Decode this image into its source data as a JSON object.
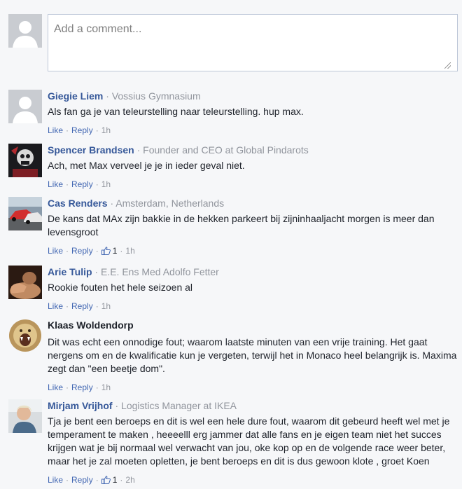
{
  "composer": {
    "placeholder": "Add a comment..."
  },
  "actions": {
    "like": "Like",
    "reply": "Reply"
  },
  "comments": [
    {
      "name": "Giegie Liem",
      "affiliation": "Vossius Gymnasium",
      "text": "Als fan ga je van teleurstelling naar teleurstelling. hup max.",
      "time": "1h",
      "likes": ""
    },
    {
      "name": "Spencer Brandsen",
      "affiliation": "Founder and CEO at Global Pindarots",
      "text": "Ach, met Max verveel je je in ieder geval niet.",
      "time": "1h",
      "likes": ""
    },
    {
      "name": "Cas Renders",
      "affiliation": "Amsterdam, Netherlands",
      "text": "De kans dat MAx zijn bakkie in de hekken parkeert bij zijninhaaljacht morgen is meer dan levensgroot",
      "time": "1h",
      "likes": "1"
    },
    {
      "name": "Arie Tulip",
      "affiliation": "E.E. Ens Med Adolfo Fetter",
      "text": "Rookie fouten het hele seizoen al",
      "time": "1h",
      "likes": ""
    },
    {
      "name": "Klaas Woldendorp",
      "affiliation": "",
      "text": "Dit was echt een onnodige fout; waarom laatste minuten van een vrije training. Het gaat nergens om en de kwalificatie kun je vergeten, terwijl het in Monaco heel belangrijk is. Maxima zegt dan \"een beetje dom\".",
      "time": "1h",
      "likes": ""
    },
    {
      "name": "Mirjam Vrijhof",
      "affiliation": "Logistics Manager at IKEA",
      "text": "Tja je bent een beroeps en dit is wel een hele dure fout, waarom dit gebeurd heeft wel met je temperament te maken , heeeelll erg jammer dat alle fans en je eigen team niet het succes krijgen wat je bij normaal wel verwacht van jou, oke kop op en de volgende race weer beter, maar het je zal moeten opletten, je bent beroeps en dit is dus gewoon klote , groet Koen",
      "time": "2h",
      "likes": "1"
    }
  ]
}
